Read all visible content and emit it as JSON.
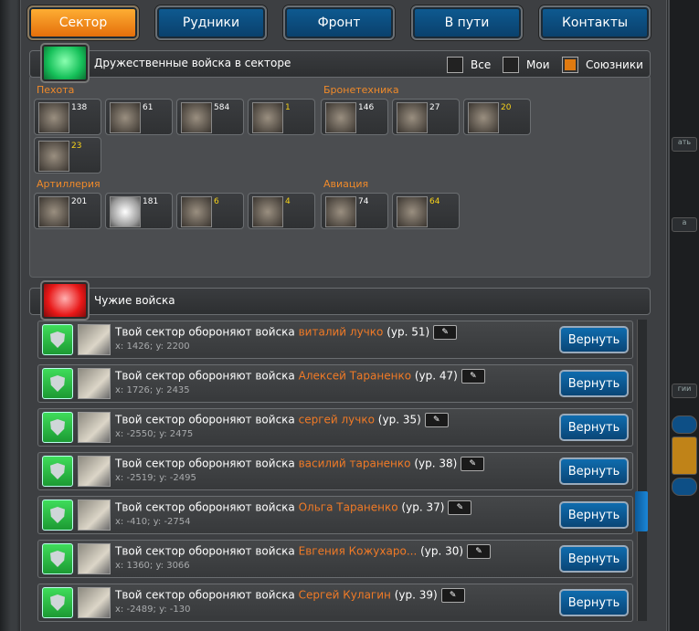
{
  "tabs": [
    {
      "label": "Сектор"
    },
    {
      "label": "Рудники"
    },
    {
      "label": "Фронт"
    },
    {
      "label": "В пути"
    },
    {
      "label": "Контакты"
    }
  ],
  "friendly": {
    "title": "Дружественные войска в секторе",
    "filters": {
      "all": "Все",
      "mine": "Мои",
      "allies": "Союзники"
    },
    "categories": {
      "infantry": "Пехота",
      "armor": "Бронетехника",
      "artillery": "Артиллерия",
      "aviation": "Авиация"
    },
    "units": {
      "infantry": [
        "138",
        "61",
        "584",
        "1",
        "23"
      ],
      "armor": [
        "146",
        "27",
        "20"
      ],
      "artillery": [
        "201",
        "181",
        "6",
        "4"
      ],
      "aviation": [
        "74",
        "64"
      ]
    }
  },
  "foreign": {
    "title": "Чужие войска",
    "prefix": "Твой сектор обороняют войска",
    "return_label": "Вернуть",
    "rows": [
      {
        "name": "виталий лучко",
        "level": "(ур. 51)",
        "coords": "x: 1426; y: 2200"
      },
      {
        "name": "Алексей Тараненко",
        "level": "(ур. 47)",
        "coords": "x: 1726; y: 2435"
      },
      {
        "name": "сергей лучко",
        "level": "(ур. 35)",
        "coords": "x: -2550; y: 2475"
      },
      {
        "name": "василий тараненко",
        "level": "(ур. 38)",
        "coords": "x: -2519; y: -2495"
      },
      {
        "name": "Ольга Тараненко",
        "level": "(ур. 37)",
        "coords": "x: -410; y: -2754"
      },
      {
        "name": "Евгения Кожухаро...",
        "level": "(ур. 30)",
        "coords": "x: 1360; y: 3066"
      },
      {
        "name": "Сергей Кулагин",
        "level": "(ур. 39)",
        "coords": "x: -2489; y: -130"
      }
    ]
  },
  "side": {
    "a": "ать",
    "b": "а",
    "c": "гии"
  }
}
